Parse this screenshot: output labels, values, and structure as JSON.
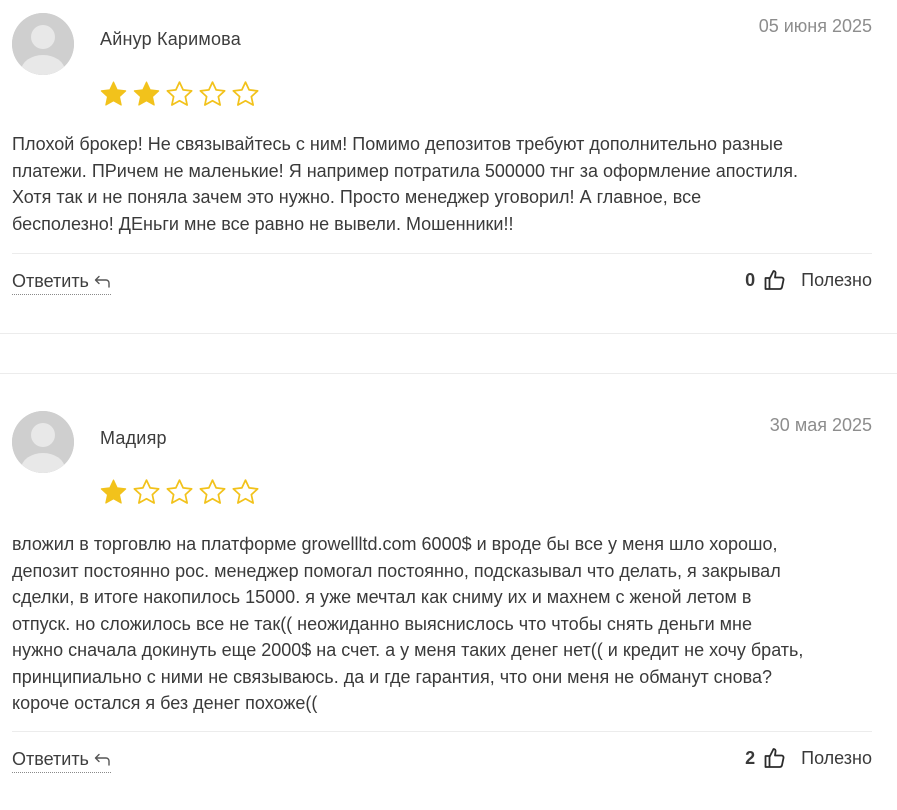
{
  "reviews": [
    {
      "author": "Айнур Каримова",
      "date": "05 июня 2025",
      "rating": 2,
      "max_rating": 5,
      "text_lines": [
        "Плохой брокер! Не связывайтесь с ним! Помимо депозитов требуют дополнительно разные",
        "платежи. ПРичем не маленькие! Я например потратила 500000 тнг за оформление апостиля.",
        "Хотя так и не поняла зачем это нужно. Просто менеджер уговорил! А главное, все",
        "бесполезно! ДЕньги мне все равно не вывели. Мошенники!!"
      ],
      "reply_label": "Ответить",
      "helpful_count": "0",
      "helpful_label": "Полезно"
    },
    {
      "author": "Мадияр",
      "date": "30 мая 2025",
      "rating": 1,
      "max_rating": 5,
      "text_lines": [
        "вложил в торговлю на платформе growellltd.com 6000$ и вроде бы все у меня шло хорошо,",
        "депозит постоянно рос. менеджер помогал постоянно, подсказывал что делать, я закрывал",
        "сделки, в итоге накопилось 15000. я уже мечтал как сниму их и махнем с женой летом в",
        "отпуск. но сложилось все не так(( неожиданно выяснислось что чтобы снять деньги мне",
        "нужно сначала докинуть еще 2000$ на счет. а у меня таких денег нет(( и кредит не хочу брать,",
        "принципиально с ними не связываюсь. да и где гарантия, что они меня не обманут снова?",
        "короче остался я без денег похоже(("
      ],
      "reply_label": "Ответить",
      "helpful_count": "2",
      "helpful_label": "Полезно"
    }
  ],
  "colors": {
    "star_filled": "#f2c21b",
    "star_empty_stroke": "#f2c21b",
    "avatar_bg": "#cfcfcf",
    "date_text": "#8d8d8d",
    "divider": "#ececec"
  },
  "icons": {
    "avatar": "user-avatar-icon",
    "star": "star-icon",
    "reply": "reply-arrow-icon",
    "helpful": "thumbs-up-icon"
  }
}
